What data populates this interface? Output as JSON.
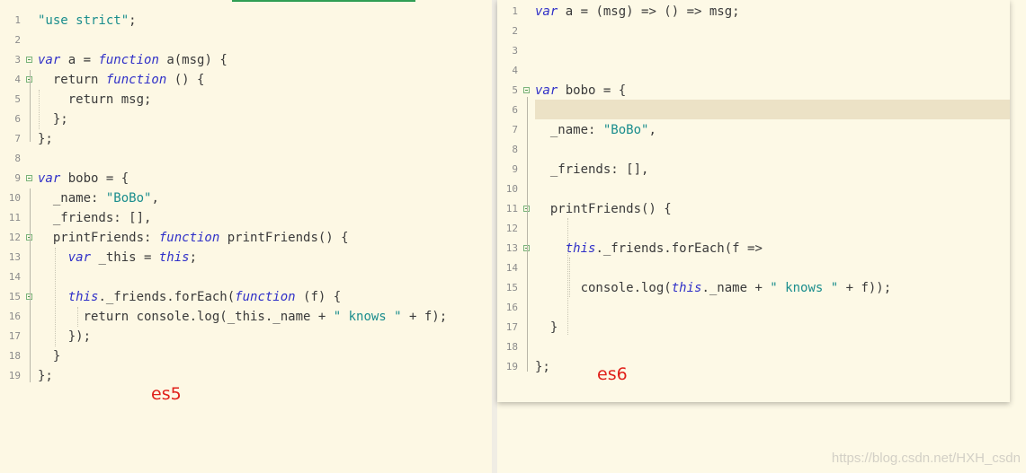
{
  "left_panel": {
    "label": "es5",
    "lines": [
      {
        "n": "1",
        "fold": false,
        "html": "<span class=\"str\">\"use strict\"</span>;"
      },
      {
        "n": "2",
        "fold": false,
        "html": ""
      },
      {
        "n": "3",
        "fold": true,
        "html": "<span class=\"kw\">var</span> a = <span class=\"kw\">function</span> a(msg) {"
      },
      {
        "n": "4",
        "fold": true,
        "html": "  return <span class=\"kw\">function</span> () {"
      },
      {
        "n": "5",
        "fold": false,
        "html": "    return msg;"
      },
      {
        "n": "6",
        "fold": false,
        "html": "  };"
      },
      {
        "n": "7",
        "fold": false,
        "html": "};"
      },
      {
        "n": "8",
        "fold": false,
        "html": ""
      },
      {
        "n": "9",
        "fold": true,
        "html": "<span class=\"kw\">var</span> bobo = {"
      },
      {
        "n": "10",
        "fold": false,
        "html": "  _name: <span class=\"str\">\"BoBo\"</span>,"
      },
      {
        "n": "11",
        "fold": false,
        "html": "  _friends: [],"
      },
      {
        "n": "12",
        "fold": true,
        "html": "  printFriends: <span class=\"kw\">function</span> printFriends() {"
      },
      {
        "n": "13",
        "fold": false,
        "html": "    <span class=\"kw\">var</span> _this = <span class=\"kw\">this</span>;"
      },
      {
        "n": "14",
        "fold": false,
        "html": ""
      },
      {
        "n": "15",
        "fold": true,
        "html": "    <span class=\"kw\">this</span>._friends.forEach(<span class=\"kw\">function</span> (f) {"
      },
      {
        "n": "16",
        "fold": false,
        "html": "      return console.log(_this._name + <span class=\"str\">\" knows \"</span> + f);"
      },
      {
        "n": "17",
        "fold": false,
        "html": "    });"
      },
      {
        "n": "18",
        "fold": false,
        "html": "  }"
      },
      {
        "n": "19",
        "fold": false,
        "html": "};"
      }
    ]
  },
  "right_panel": {
    "label": "es6",
    "lines": [
      {
        "n": "1",
        "fold": false,
        "html": "<span class=\"kw\">var</span> a = (msg) => () => msg;"
      },
      {
        "n": "2",
        "fold": false,
        "html": ""
      },
      {
        "n": "3",
        "fold": false,
        "html": ""
      },
      {
        "n": "4",
        "fold": false,
        "html": ""
      },
      {
        "n": "5",
        "fold": true,
        "html": "<span class=\"kw\">var</span> bobo = {"
      },
      {
        "n": "6",
        "fold": false,
        "html": ""
      },
      {
        "n": "7",
        "fold": false,
        "html": "  _name: <span class=\"str\">\"BoBo\"</span>,"
      },
      {
        "n": "8",
        "fold": false,
        "html": ""
      },
      {
        "n": "9",
        "fold": false,
        "html": "  _friends: [],"
      },
      {
        "n": "10",
        "fold": false,
        "html": ""
      },
      {
        "n": "11",
        "fold": true,
        "html": "  printFriends() {"
      },
      {
        "n": "12",
        "fold": false,
        "html": ""
      },
      {
        "n": "13",
        "fold": true,
        "html": "    <span class=\"kw\">this</span>._friends.forEach(f =>"
      },
      {
        "n": "14",
        "fold": false,
        "html": ""
      },
      {
        "n": "15",
        "fold": false,
        "html": "      console.log(<span class=\"kw\">this</span>._name + <span class=\"str\">\" knows \"</span> + f));"
      },
      {
        "n": "16",
        "fold": false,
        "html": ""
      },
      {
        "n": "17",
        "fold": false,
        "html": "  }"
      },
      {
        "n": "18",
        "fold": false,
        "html": ""
      },
      {
        "n": "19",
        "fold": false,
        "html": "};"
      }
    ]
  },
  "watermark": "https://blog.csdn.net/HXH_csdn",
  "colors": {
    "keyword": "#3030c8",
    "string": "#1a8d8d",
    "label": "#e0201a",
    "line_highlight": "#ece2c6"
  }
}
